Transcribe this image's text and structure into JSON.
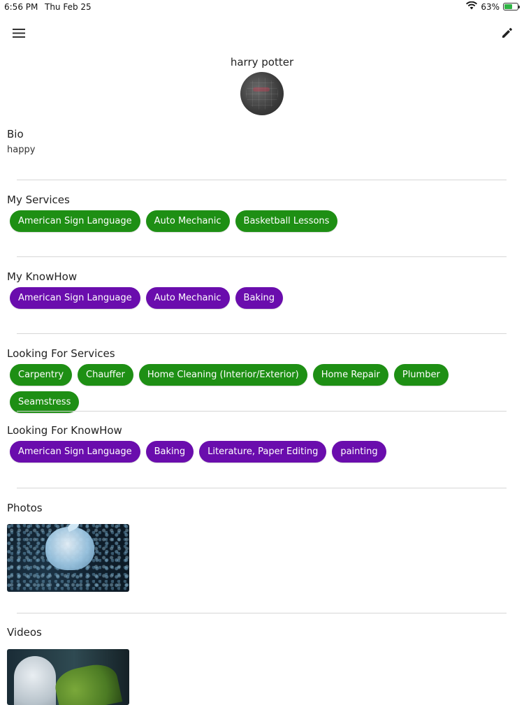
{
  "status_bar": {
    "time": "6:56 PM",
    "date": "Thu Feb 25",
    "battery": "63%",
    "battery_level": 0.63
  },
  "header": {
    "menu_icon": "hamburger-icon",
    "edit_icon": "pencil-icon"
  },
  "profile": {
    "name": "harry potter"
  },
  "bio": {
    "title": "Bio",
    "text": "happy"
  },
  "my_services": {
    "title": "My Services",
    "items": [
      "American Sign Language",
      "Auto Mechanic",
      "Basketball Lessons"
    ]
  },
  "my_knowhow": {
    "title": "My KnowHow",
    "items": [
      "American Sign Language",
      "Auto Mechanic",
      "Baking"
    ]
  },
  "looking_services": {
    "title": "Looking For Services",
    "items": [
      "Carpentry",
      "Chauffer",
      "Home Cleaning (Interior/Exterior)",
      "Home Repair",
      "Plumber",
      "Seamstress"
    ]
  },
  "looking_knowhow": {
    "title": "Looking For KnowHow",
    "items": [
      "American Sign Language",
      "Baking",
      "Literature, Paper Editing",
      "painting"
    ]
  },
  "photos": {
    "title": "Photos"
  },
  "videos": {
    "title": "Videos"
  },
  "colors": {
    "service_chip": "#1e8f14",
    "knowhow_chip": "#6a0dad"
  }
}
